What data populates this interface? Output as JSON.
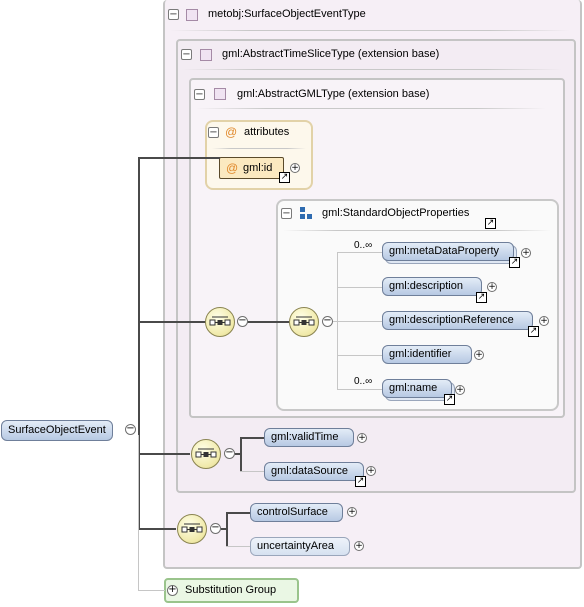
{
  "root_element": "SurfaceObjectEvent",
  "type_box": {
    "title": "metobj:SurfaceObjectEventType",
    "toggle": "−"
  },
  "ext_box_1": {
    "title": "gml:AbstractTimeSliceType (extension base)",
    "toggle": "−"
  },
  "ext_box_2": {
    "title": "gml:AbstractGMLType (extension base)",
    "toggle": "−"
  },
  "attributes_box": {
    "title": "attributes",
    "at_symbol": "@",
    "items": [
      "gml:id"
    ],
    "toggle": "−"
  },
  "std_props": {
    "title": "gml:StandardObjectProperties",
    "toggle": "−"
  },
  "std_elements": [
    "gml:metaDataProperty",
    "gml:description",
    "gml:descriptionReference",
    "gml:identifier",
    "gml:name"
  ],
  "occurrences": {
    "metadata": "0..∞",
    "name": "0..∞"
  },
  "sequence_2": [
    "gml:validTime",
    "gml:dataSource"
  ],
  "sequence_3": [
    "controlSurface",
    "uncertaintyArea"
  ],
  "substitution_group": {
    "label": "Substitution Group",
    "toggle": "+"
  },
  "symbols": {
    "collapse": "−",
    "expand": "+",
    "link_arrow": "↗"
  },
  "colors": {
    "element_fill": "#c9d8ec",
    "element_border": "#6f7f9a",
    "type_panel_bg": "#f6eff6",
    "attributes_bg": "#fdf8ec",
    "attributes_border": "#e2d2a8",
    "compositor_fill": "#f0e9a8",
    "substitution_bg": "#eaf7e4",
    "substitution_border": "#9ac48c",
    "line": "#4a4a4a",
    "panel_border": "#c4c4c4"
  }
}
